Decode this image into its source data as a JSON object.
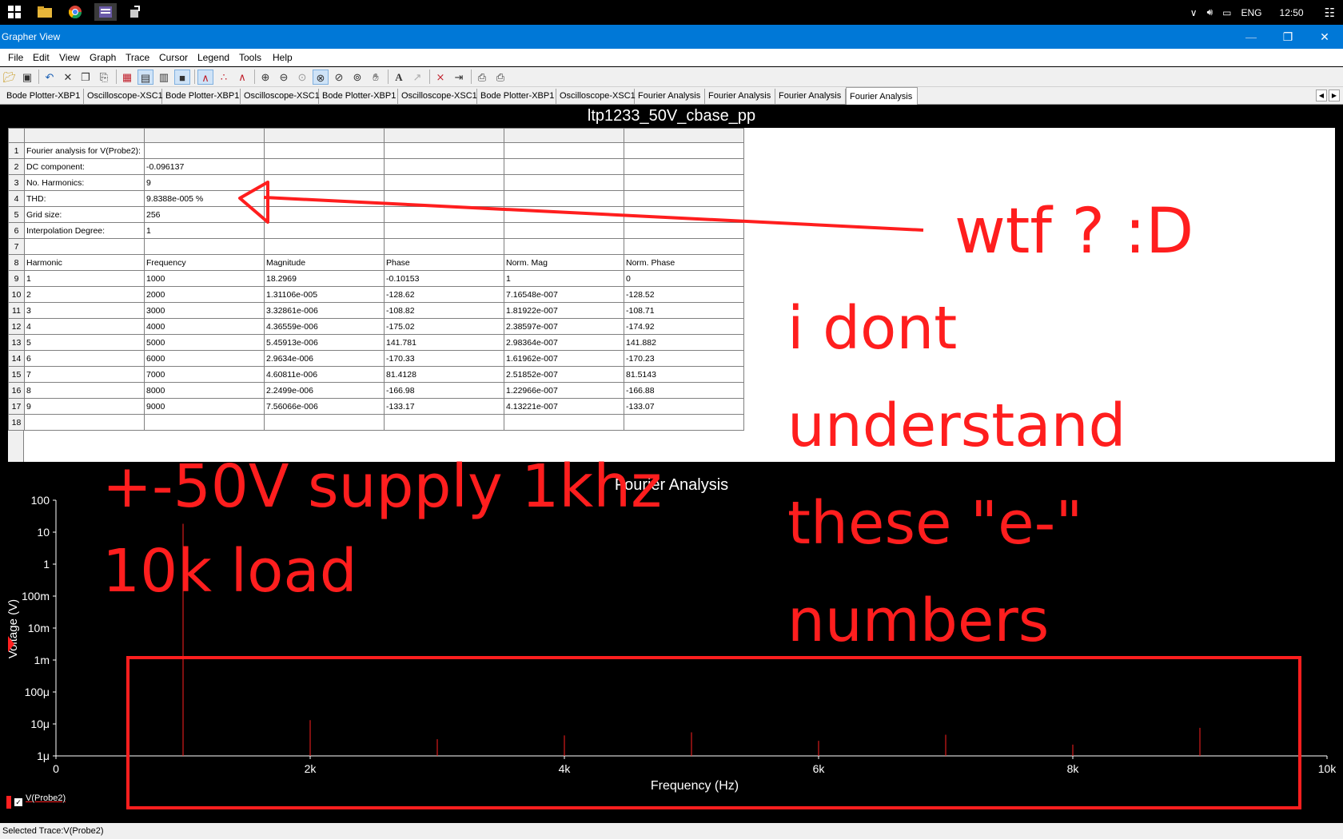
{
  "taskbar": {
    "icons": [
      "windows-start-icon",
      "file-explorer-icon",
      "chrome-icon",
      "multisim-icon",
      "app-icon"
    ],
    "tray": {
      "language": "ENG",
      "time": "12:50"
    }
  },
  "window": {
    "title": "Grapher View"
  },
  "menu": [
    "File",
    "Edit",
    "View",
    "Graph",
    "Trace",
    "Cursor",
    "Legend",
    "Tools",
    "Help"
  ],
  "tabs": [
    "Bode Plotter-XBP1",
    "Oscilloscope-XSC1",
    "Bode Plotter-XBP1",
    "Oscilloscope-XSC1",
    "Bode Plotter-XBP1",
    "Oscilloscope-XSC1",
    "Bode Plotter-XBP1",
    "Oscilloscope-XSC1",
    "Fourier Analysis",
    "Fourier Analysis",
    "Fourier Analysis",
    "Fourier Analysis"
  ],
  "active_tab": 11,
  "document_title": "ltp1233_50V_cbase_pp",
  "grid": {
    "rows": [
      [
        "Fourier analysis for V(Probe2):",
        "",
        "",
        "",
        "",
        ""
      ],
      [
        "DC component:",
        "-0.096137",
        "",
        "",
        "",
        ""
      ],
      [
        "No. Harmonics:",
        "9",
        "",
        "",
        "",
        ""
      ],
      [
        "THD:",
        "9.8388e-005 %",
        "",
        "",
        "",
        ""
      ],
      [
        "Grid size:",
        "256",
        "",
        "",
        "",
        ""
      ],
      [
        "Interpolation Degree:",
        "1",
        "",
        "",
        "",
        ""
      ],
      [
        "",
        "",
        "",
        "",
        "",
        ""
      ],
      [
        "Harmonic",
        "Frequency",
        "Magnitude",
        "Phase",
        "Norm. Mag",
        "Norm. Phase"
      ],
      [
        "1",
        "1000",
        "18.2969",
        "-0.10153",
        "1",
        "0"
      ],
      [
        "2",
        "2000",
        "1.31106e-005",
        "-128.62",
        "7.16548e-007",
        "-128.52"
      ],
      [
        "3",
        "3000",
        "3.32861e-006",
        "-108.82",
        "1.81922e-007",
        "-108.71"
      ],
      [
        "4",
        "4000",
        "4.36559e-006",
        "-175.02",
        "2.38597e-007",
        "-174.92"
      ],
      [
        "5",
        "5000",
        "5.45913e-006",
        "141.781",
        "2.98364e-007",
        "141.882"
      ],
      [
        "6",
        "6000",
        "2.9634e-006",
        "-170.33",
        "1.61962e-007",
        "-170.23"
      ],
      [
        "7",
        "7000",
        "4.60811e-006",
        "81.4128",
        "2.51852e-007",
        "81.5143"
      ],
      [
        "8",
        "8000",
        "2.2499e-006",
        "-166.98",
        "1.22966e-007",
        "-166.88"
      ],
      [
        "9",
        "9000",
        "7.56066e-006",
        "-133.17",
        "4.13221e-007",
        "-133.07"
      ],
      [
        "",
        "",
        "",
        "",
        "",
        ""
      ]
    ]
  },
  "chart": {
    "title": "Fourier Analysis",
    "xlabel": "Frequency (Hz)",
    "ylabel": "Voltage (V)",
    "legend_label": "V(Probe2)",
    "trace_color": "#ff2020"
  },
  "chart_data": {
    "type": "bar",
    "title": "Fourier Analysis",
    "xlabel": "Frequency (Hz)",
    "ylabel": "Voltage (V)",
    "y_scale": "log",
    "ylim": [
      1e-06,
      100
    ],
    "xlim": [
      0,
      10000
    ],
    "x_ticks": [
      {
        "v": 0,
        "label": "0"
      },
      {
        "v": 2000,
        "label": "2k"
      },
      {
        "v": 4000,
        "label": "4k"
      },
      {
        "v": 6000,
        "label": "6k"
      },
      {
        "v": 8000,
        "label": "8k"
      },
      {
        "v": 10000,
        "label": "10k"
      }
    ],
    "y_ticks": [
      {
        "v": 100,
        "label": "100"
      },
      {
        "v": 10,
        "label": "10"
      },
      {
        "v": 1,
        "label": "1"
      },
      {
        "v": 0.1,
        "label": "100m"
      },
      {
        "v": 0.01,
        "label": "10m"
      },
      {
        "v": 0.001,
        "label": "1m"
      },
      {
        "v": 0.0001,
        "label": "100μ"
      },
      {
        "v": 1e-05,
        "label": "10μ"
      },
      {
        "v": 1e-06,
        "label": "1μ"
      }
    ],
    "series": [
      {
        "name": "V(Probe2)",
        "x": [
          1000,
          2000,
          3000,
          4000,
          5000,
          6000,
          7000,
          8000,
          9000
        ],
        "values": [
          18.2969,
          1.31106e-05,
          3.32861e-06,
          4.36559e-06,
          5.45913e-06,
          2.9634e-06,
          4.60811e-06,
          2.2499e-06,
          7.56066e-06
        ]
      }
    ]
  },
  "annotations": {
    "wtf": "wtf ? :D",
    "dont_understand": [
      "i dont",
      "understand",
      "these \"e-\"",
      "numbers"
    ],
    "supply": "+-50V supply 1khz",
    "load": "10k load",
    "color": "#ff1e1e"
  },
  "status": "Selected Trace:V(Probe2)"
}
